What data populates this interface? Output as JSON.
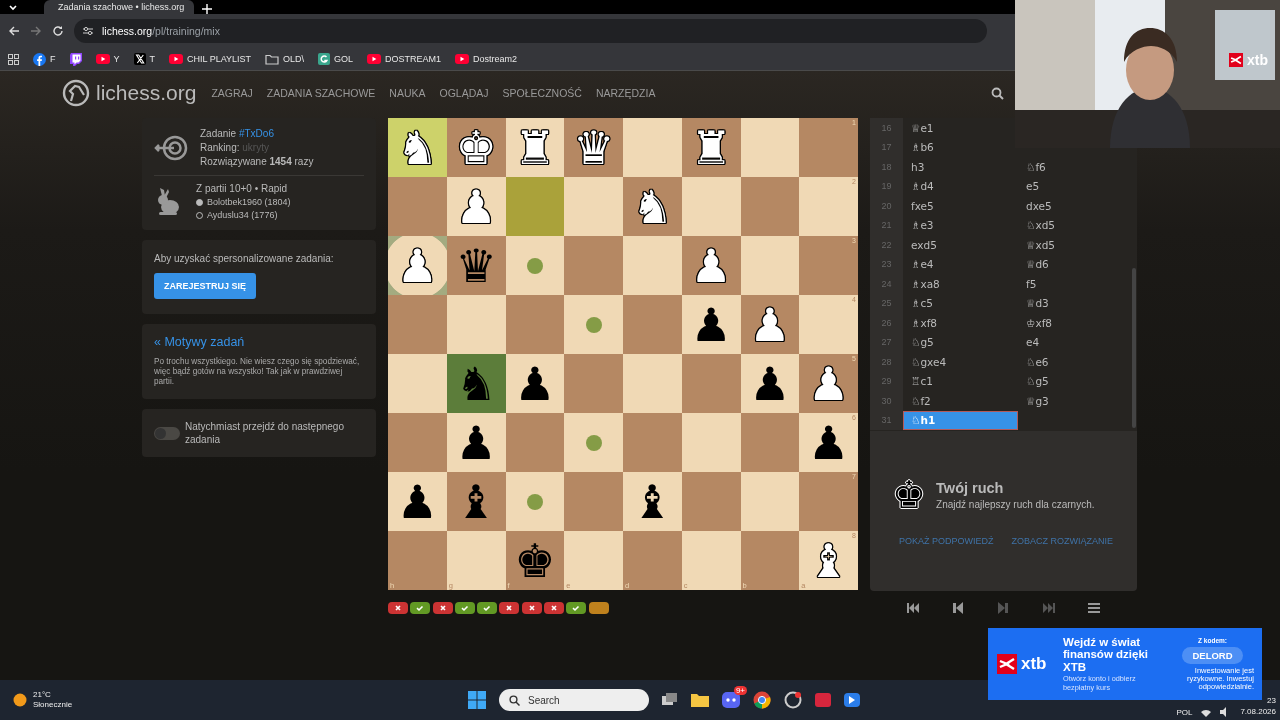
{
  "browser": {
    "tab_title": "Zadania szachowe • lichess.org",
    "url_host": "lichess.org",
    "url_path": "/pl/training/mix",
    "bookmarks": [
      {
        "label": "F",
        "kind": "facebook"
      },
      {
        "kind": "twitch"
      },
      {
        "label": "Y",
        "kind": "youtube"
      },
      {
        "label": "T",
        "kind": "x"
      },
      {
        "label": "CHIL PLAYLIST",
        "kind": "youtube"
      },
      {
        "label": "OLD\\",
        "kind": "folder"
      },
      {
        "label": "GOL",
        "kind": "g"
      },
      {
        "label": "DOSTREAM1",
        "kind": "youtube"
      },
      {
        "label": "Dostream2",
        "kind": "youtube"
      }
    ]
  },
  "site_header": {
    "logo": "lichess.org",
    "nav": [
      "ZAGRAJ",
      "ZADANIA SZACHOWE",
      "NAUKA",
      "OGLĄDAJ",
      "SPOŁECZNOŚĆ",
      "NARZĘDZIA"
    ]
  },
  "puzzle_info": {
    "title": "Zadanie",
    "puzzle_id": "#TxDo6",
    "ranking_label": "Ranking:",
    "ranking_value": "ukryty",
    "solved": "Rozwiązywane **1454** razy",
    "game": "Z partii 10+0 • Rapid",
    "players": [
      {
        "name": "Bolotbek1960 (1804)",
        "kind": "white"
      },
      {
        "name": "Ayduslu34 (1776)",
        "kind": "black"
      }
    ]
  },
  "signup": {
    "text": "Aby uzyskać spersonalizowane zadania:",
    "button": "ZAREJESTRUJ SIĘ"
  },
  "themes": {
    "link": "« Motywy zadań",
    "description": "Po trochu wszystkiego. Nie wiesz czego się spodziewać, więc bądź gotów na wszystko! Tak jak w prawdziwej partii."
  },
  "auto_next": {
    "label": "Natychmiast przejdź do następnego zadania",
    "on": false
  },
  "board": {
    "ranks": [
      "1",
      "2",
      "3",
      "4",
      "5",
      "6",
      "7",
      "8"
    ],
    "files": [
      "h",
      "g",
      "f",
      "e",
      "d",
      "c",
      "b",
      "a"
    ],
    "rows": [
      [
        {
          "piece": "♞",
          "kind": "white",
          "last_move": true
        },
        {
          "piece": "♚",
          "kind": "white"
        },
        {
          "piece": "♜",
          "kind": "white"
        },
        {
          "piece": "♛",
          "kind": "white"
        },
        {},
        {
          "piece": "♜",
          "kind": "white"
        },
        {},
        {}
      ],
      [
        {},
        {
          "piece": "♟",
          "kind": "white"
        },
        {
          "last_move": true
        },
        {},
        {
          "piece": "♞",
          "kind": "white"
        },
        {},
        {},
        {}
      ],
      [
        {
          "piece": "♟",
          "kind": "white",
          "capture": true
        },
        {
          "piece": "♛",
          "kind": "black"
        },
        {
          "dot": true
        },
        {},
        {},
        {
          "piece": "♟",
          "kind": "white"
        },
        {},
        {}
      ],
      [
        {},
        {},
        {},
        {
          "dot": true
        },
        {},
        {
          "piece": "♟",
          "kind": "black"
        },
        {
          "piece": "♟",
          "kind": "white"
        },
        {}
      ],
      [
        {},
        {
          "piece": "♞",
          "kind": "black",
          "selected": true
        },
        {
          "piece": "♟",
          "kind": "black"
        },
        {},
        {},
        {},
        {
          "piece": "♟",
          "kind": "black"
        },
        {
          "piece": "♟",
          "kind": "white"
        }
      ],
      [
        {},
        {
          "piece": "♟",
          "kind": "black"
        },
        {},
        {
          "dot": true
        },
        {},
        {},
        {},
        {
          "piece": "♟",
          "kind": "black"
        }
      ],
      [
        {
          "piece": "♟",
          "kind": "black"
        },
        {
          "piece": "♝",
          "kind": "black"
        },
        {
          "dot": true
        },
        {},
        {
          "piece": "♝",
          "kind": "black"
        },
        {},
        {},
        {}
      ],
      [
        {},
        {},
        {
          "piece": "♚",
          "kind": "black"
        },
        {},
        {},
        {},
        {},
        {
          "piece": "♝",
          "kind": "white"
        }
      ]
    ]
  },
  "history": [
    {
      "kind": "fail"
    },
    {
      "kind": "pass"
    },
    {
      "kind": "fail"
    },
    {
      "kind": "pass"
    },
    {
      "kind": "pass"
    },
    {
      "kind": "fail"
    },
    {
      "kind": "fail"
    },
    {
      "kind": "fail"
    },
    {
      "kind": "pass"
    },
    {
      "kind": "current"
    }
  ],
  "moves": [
    {
      "number": "16",
      "white": "♕e1",
      "selected": false
    },
    {
      "number": "17",
      "white": "♗b6",
      "selected": false
    },
    {
      "number": "18",
      "white": "h3",
      "black": "♘f6",
      "selected": false
    },
    {
      "number": "19",
      "white": "♗d4",
      "black": "e5",
      "selected": false
    },
    {
      "number": "20",
      "white": "fxe5",
      "black": "dxe5",
      "selected": false
    },
    {
      "number": "21",
      "white": "♗e3",
      "black": "♘xd5",
      "selected": false
    },
    {
      "number": "22",
      "white": "exd5",
      "black": "♕xd5",
      "selected": false
    },
    {
      "number": "23",
      "white": "♗e4",
      "black": "♕d6",
      "selected": false
    },
    {
      "number": "24",
      "white": "♗xa8",
      "black": "f5",
      "selected": false
    },
    {
      "number": "25",
      "white": "♗c5",
      "black": "♕d3",
      "selected": false
    },
    {
      "number": "26",
      "white": "♗xf8",
      "black": "♔xf8",
      "selected": false
    },
    {
      "number": "27",
      "white": "♘g5",
      "black": "e4",
      "selected": false
    },
    {
      "number": "28",
      "white": "♘gxe4",
      "black": "♘e6",
      "selected": false
    },
    {
      "number": "29",
      "white": "♖c1",
      "black": "♘g5",
      "selected": false
    },
    {
      "number": "30",
      "white": "♘f2",
      "black": "♕g3",
      "selected": false
    },
    {
      "number": "31",
      "white": "♘h1",
      "selected": true
    }
  ],
  "turn": {
    "piece": "♚",
    "title": "Twój ruch",
    "subtitle": "Znajdź najlepszy ruch dla czarnych.",
    "actions": [
      "POKAŻ PODPOWIEDŹ",
      "ZOBACZ ROZWIĄZANIE"
    ]
  },
  "controls": [
    {
      "kind": "first",
      "disabled": false
    },
    {
      "kind": "prev",
      "disabled": false
    },
    {
      "kind": "next",
      "disabled": true
    },
    {
      "kind": "last",
      "disabled": true
    },
    {
      "kind": "menu",
      "disabled": false
    }
  ],
  "webcam": {
    "kind": "picture",
    "badge": "xtb"
  },
  "ad": {
    "logo": "xtb",
    "headline": "Wejdź w świat finansów dzięki XTB",
    "subline": "Otwórz konto i odbierz bezpłatny kurs",
    "code_label": "Z kodem:",
    "code": "DELORD",
    "disclaimer": "Inwestowanie jest ryzykowne. Inwestuj odpowiedzialnie."
  },
  "taskbar": {
    "temperature": "21°C",
    "weather": "Słonecznie",
    "search_placeholder": "Search",
    "discord_badge": "9+",
    "language": "POL",
    "time": "23",
    "date": "7.08.2026"
  }
}
